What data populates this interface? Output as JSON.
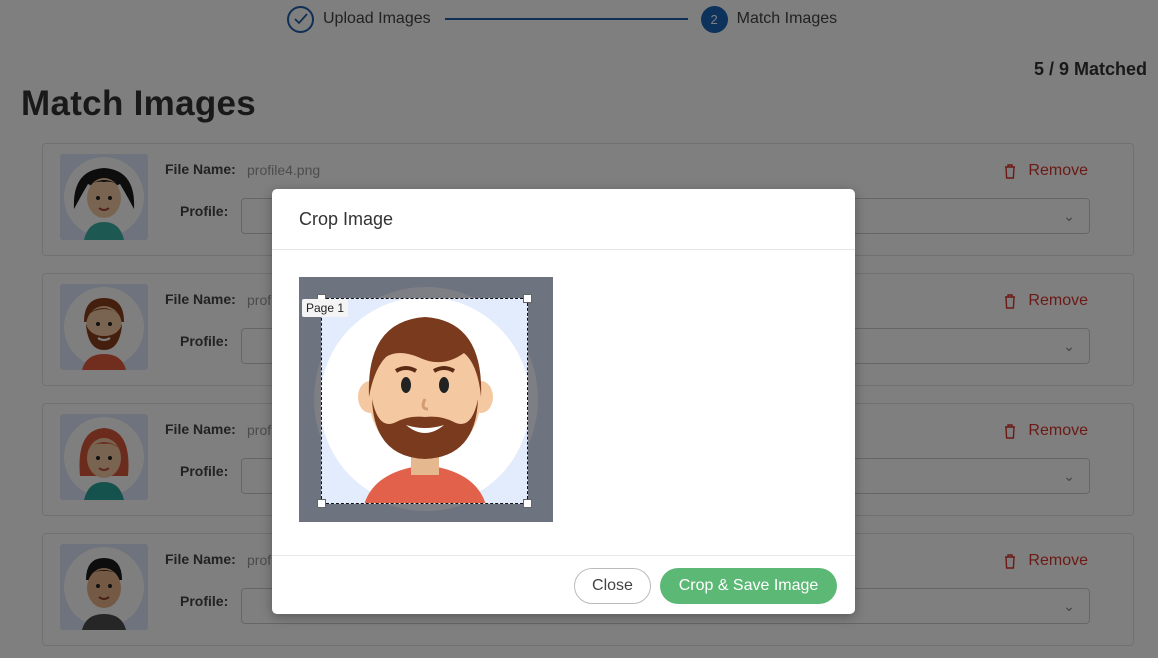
{
  "stepper": {
    "steps": [
      {
        "label": "Upload Images",
        "marker": "check-icon"
      },
      {
        "label": "Match Images",
        "number": "2"
      }
    ]
  },
  "matched_text": "5 / 9 Matched",
  "page_title": "Match Images",
  "field_labels": {
    "file_name": "File Name:",
    "profile": "Profile:"
  },
  "remove_label": "Remove",
  "cards": [
    {
      "file_name": "profile4.png",
      "avatar": "woman-dark-hair"
    },
    {
      "file_name": "prof",
      "avatar": "man-beard"
    },
    {
      "file_name": "prof",
      "avatar": "woman-red-hair"
    },
    {
      "file_name": "prof",
      "avatar": "man-dark-hair"
    }
  ],
  "modal": {
    "title": "Crop Image",
    "page_tag": "Page 1",
    "close_label": "Close",
    "save_label": "Crop & Save Image"
  },
  "colors": {
    "accent_blue": "#1a64b8",
    "remove_red": "#d9342b",
    "save_green": "#5cb875"
  }
}
